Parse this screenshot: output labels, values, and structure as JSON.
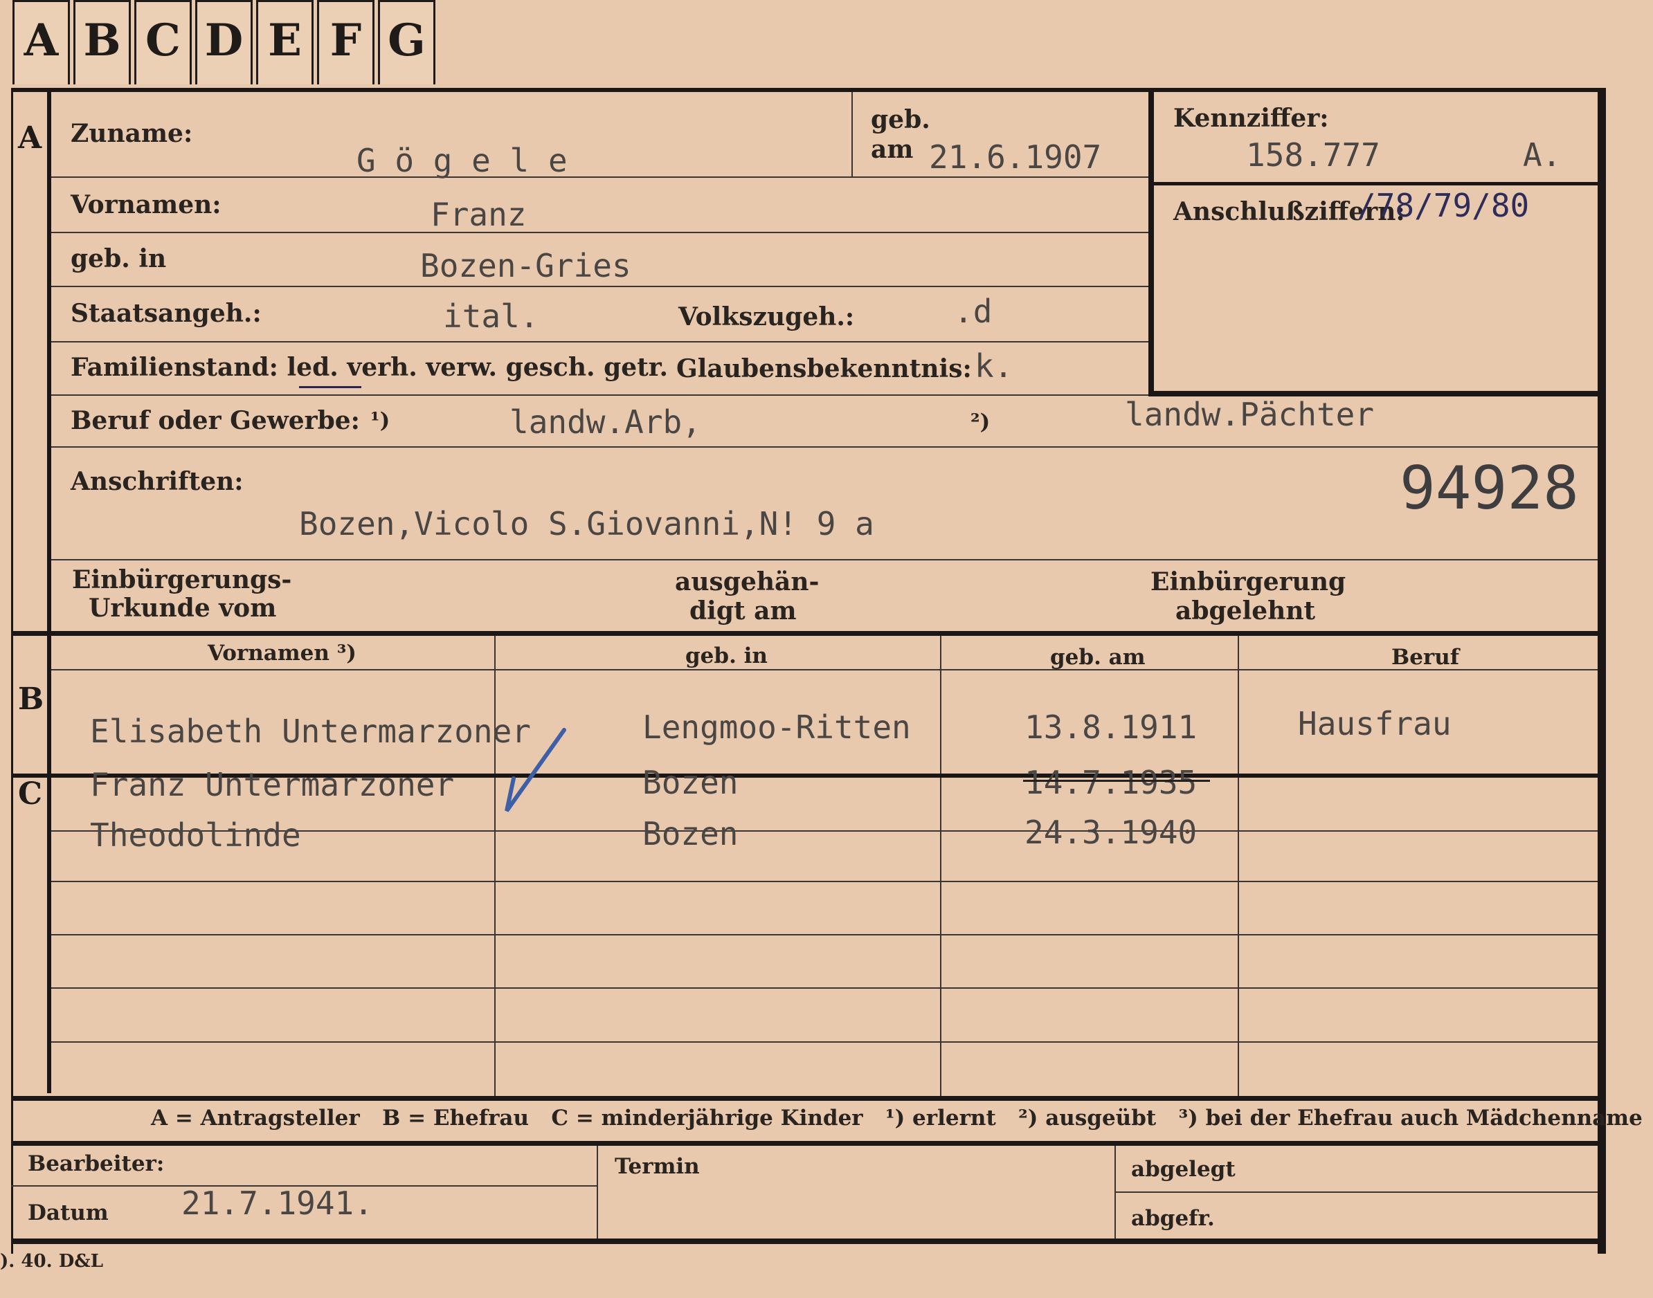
{
  "tabs": [
    "A",
    "B",
    "C",
    "D",
    "E",
    "F",
    "G"
  ],
  "sections": {
    "a": "A",
    "b": "B",
    "c": "C"
  },
  "labels": {
    "zuname": "Zuname:",
    "geb": "geb.",
    "am": "am",
    "kennziffer": "Kennziffer:",
    "anschluss": "Anschlußziffern:",
    "vornamen": "Vornamen:",
    "geb_in": "geb. in",
    "staats": "Staatsangeh.:",
    "volks": "Volkszugeh.:",
    "familienstand": "Familienstand: led. verh. verw. gesch. getr.",
    "glaube": "Glaubensbekenntnis:",
    "beruf": "Beruf oder Gewerbe:",
    "fn1": "¹)",
    "fn2": "²)",
    "anschriften": "Anschriften:",
    "einb_urk_1": "Einbürgerungs-",
    "einb_urk_2": "Urkunde vom",
    "ausg_1": "ausgehän-",
    "ausg_2": "digt am",
    "einb_abg_1": "Einbürgerung",
    "einb_abg_2": "abgelehnt"
  },
  "values": {
    "zuname": "G ö g e l e",
    "geb_am": "21.6.1907",
    "kennziffer": "158.777",
    "kennziffer_suffix": "A.",
    "anschluss": "/78/79/80",
    "vornamen": "Franz",
    "geb_in": "Bozen-Gries",
    "staats": "ital.",
    "volks": ".d",
    "glaube": "k.",
    "beruf1": "landw.Arb,",
    "beruf2": "landw.Pächter",
    "stamp": "94928",
    "anschrift": "Bozen,Vicolo S.Giovanni,N! 9 a"
  },
  "table": {
    "headers": [
      "Vornamen ³)",
      "geb. in",
      "geb. am",
      "Beruf"
    ],
    "rows": [
      {
        "name": "Elisabeth Untermarzoner",
        "place": "Lengmoo-Ritten",
        "date": "13.8.1911",
        "beruf": "Hausfrau"
      },
      {
        "name": "Franz Untermarzoner",
        "place": "Bozen",
        "date": "14.7.1935",
        "beruf": ""
      },
      {
        "name": "Theodolinde",
        "place": "Bozen",
        "date": "24.3.1940",
        "beruf": ""
      }
    ]
  },
  "legend": "A = Antragsteller   B = Ehefrau   C = minderjährige Kinder   ¹) erlernt   ²) ausgeübt   ³) bei der Ehefrau auch Mädchenname",
  "footer": {
    "bearbeiter": "Bearbeiter:",
    "datum": "Datum",
    "datum_value": "21.7.1941.",
    "termin": "Termin",
    "abgelegt": "abgelegt",
    "abgefr": "abgefr.",
    "imprint": "). 40. D&L"
  }
}
